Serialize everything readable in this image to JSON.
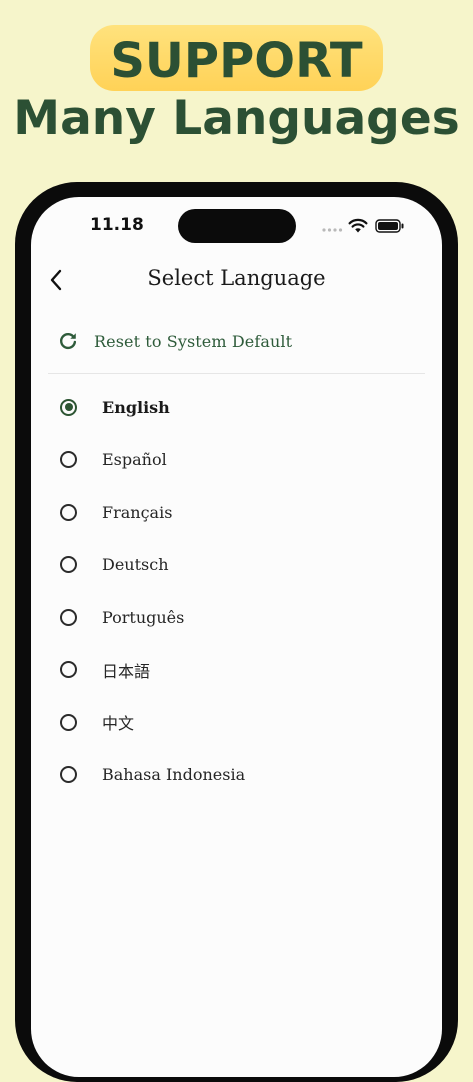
{
  "headline": {
    "top": "SUPPORT",
    "bottom": "Many Languages"
  },
  "status_bar": {
    "time": "11.18"
  },
  "screen": {
    "title": "Select Language",
    "reset_label": "Reset to System Default",
    "accent_color": "#2e5b3a",
    "languages": [
      {
        "label": "English",
        "selected": true
      },
      {
        "label": "Español",
        "selected": false
      },
      {
        "label": "Français",
        "selected": false
      },
      {
        "label": "Deutsch",
        "selected": false
      },
      {
        "label": "Português",
        "selected": false
      },
      {
        "label": "日本語",
        "selected": false
      },
      {
        "label": "中文",
        "selected": false
      },
      {
        "label": "Bahasa Indonesia",
        "selected": false
      }
    ]
  },
  "icons": {
    "back": "chevron-left-icon",
    "reset": "refresh-icon",
    "wifi": "wifi-icon",
    "battery": "battery-icon",
    "signal": "signal-dots-icon"
  }
}
